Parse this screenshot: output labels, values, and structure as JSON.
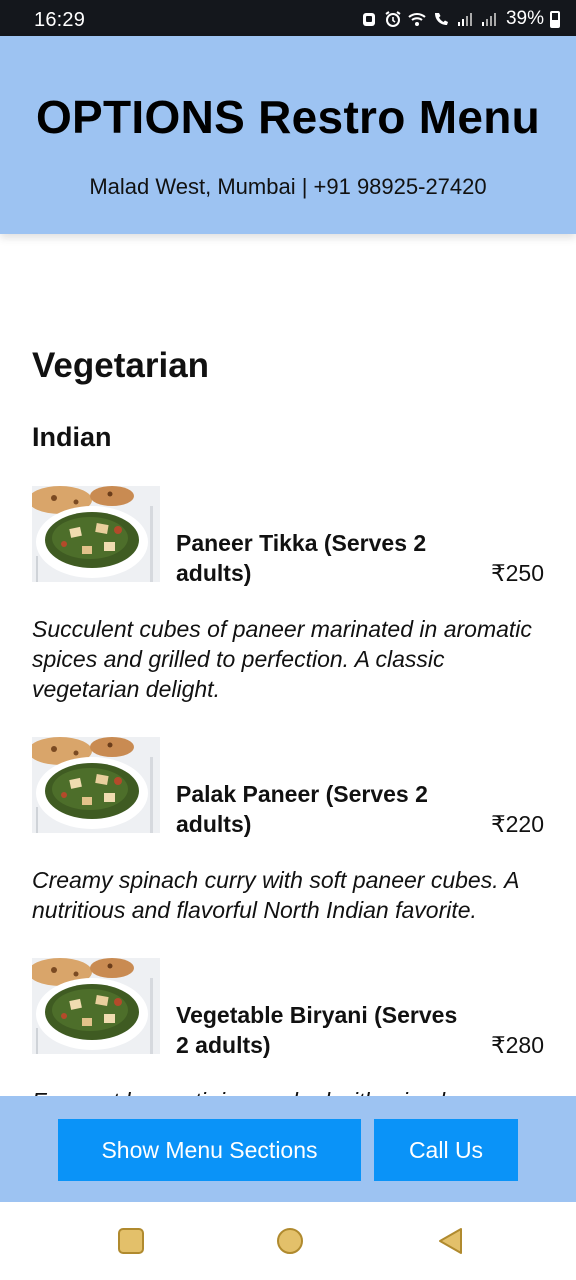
{
  "status_bar": {
    "time": "16:29",
    "battery": "39%",
    "icons": [
      "screenshot-icon",
      "alarm-icon",
      "wifi-icon",
      "wifi-calling-icon",
      "signal-icon",
      "signal-icon",
      "battery-icon"
    ]
  },
  "header": {
    "title": "OPTIONS Restro Menu",
    "subtitle": "Malad West, Mumbai | +91 98925-27420",
    "background": "#9dc3f2"
  },
  "menu": {
    "section": "Vegetarian",
    "subsection": "Indian",
    "items": [
      {
        "name": "Paneer Tikka (Serves 2 adults)",
        "price": "₹250",
        "description": "Succulent cubes of paneer marinated in aromatic spices and grilled to perfection. A classic vegetarian delight.",
        "image": "palak-paneer-dish-image"
      },
      {
        "name": "Palak Paneer (Serves 2 adults)",
        "price": "₹220",
        "description": "Creamy spinach curry with soft paneer cubes. A nutritious and flavorful North Indian favorite.",
        "image": "palak-paneer-dish-image"
      },
      {
        "name": "Vegetable Biryani (Serves 2 adults)",
        "price": "₹280",
        "description": "Fragrant basmati rice cooked with mixed vegetables and aromatic spices.",
        "image": "palak-paneer-dish-image"
      }
    ]
  },
  "actions": {
    "show_sections": "Show Menu Sections",
    "call": "Call Us",
    "button_color": "#0a93f8"
  },
  "navigation": [
    "recent-apps-icon",
    "home-icon",
    "back-icon"
  ]
}
